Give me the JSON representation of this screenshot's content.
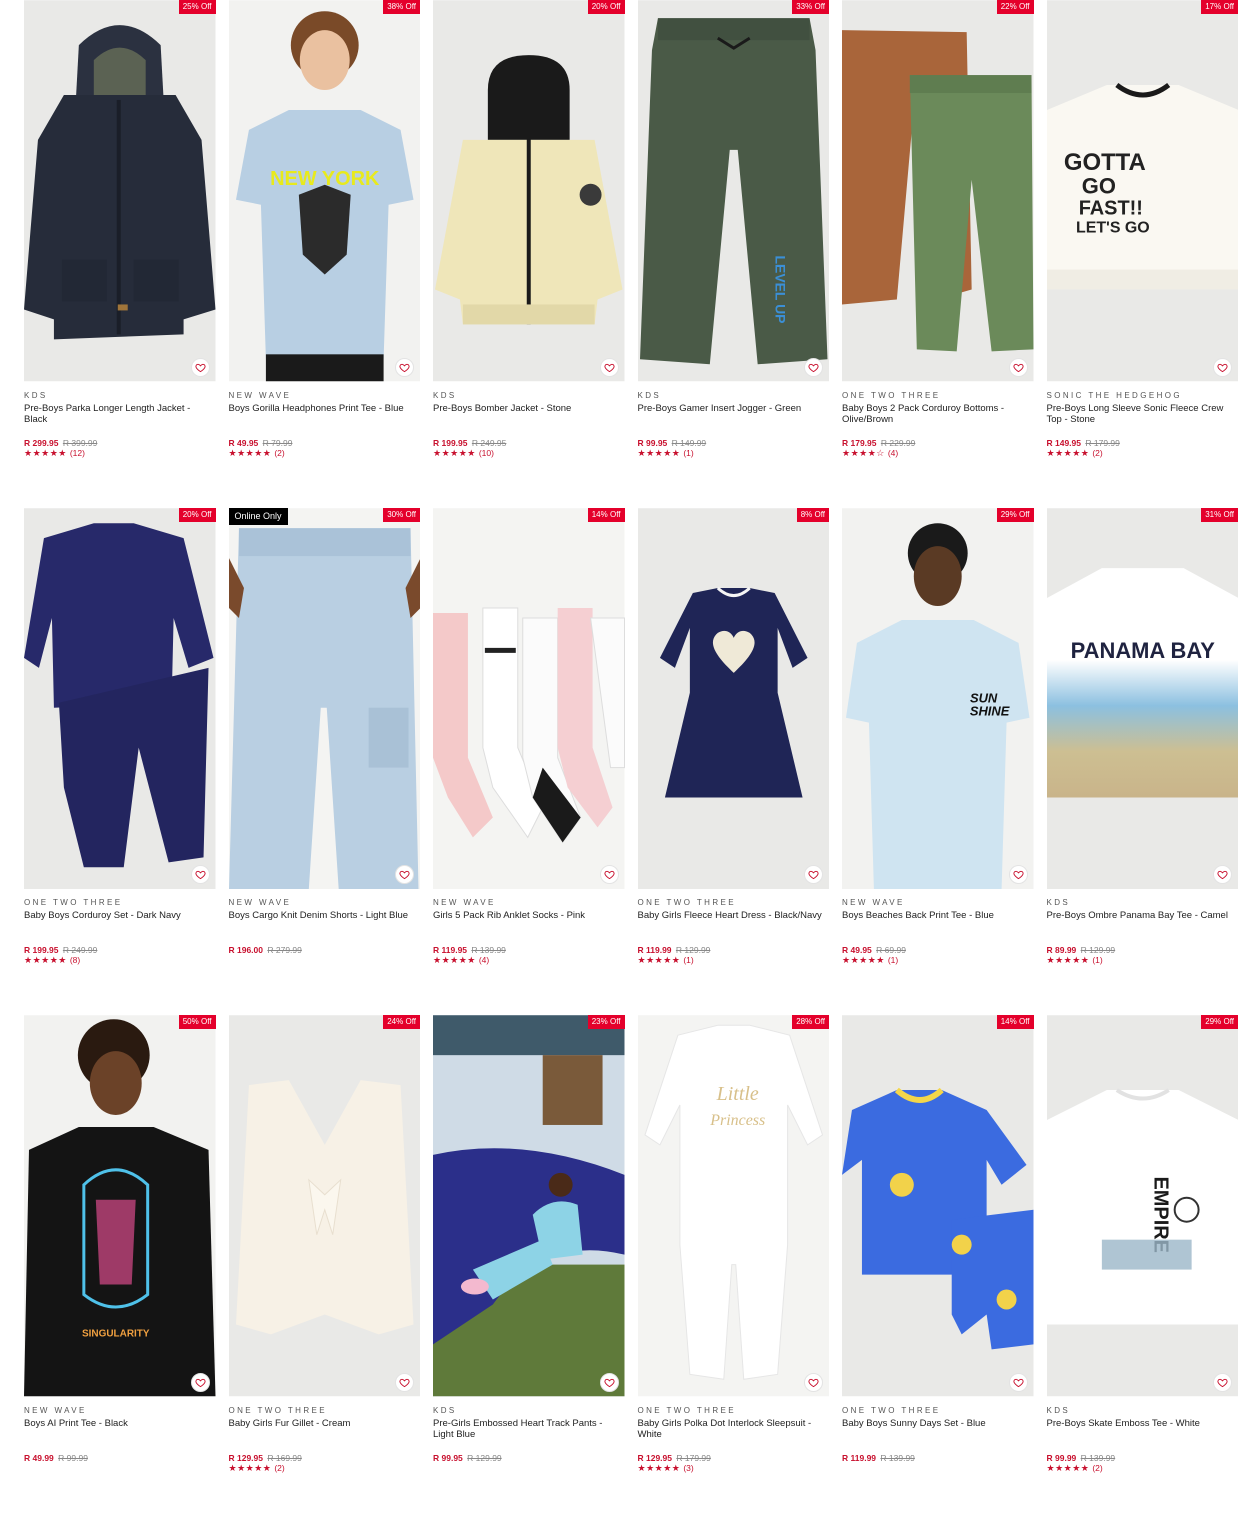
{
  "colors": {
    "accent": "#e4002b",
    "price": "#c8102e",
    "image_bg": "#e9e9e7",
    "online_badge": "#000000"
  },
  "icons": {
    "wishlist": "heart-outline-icon",
    "star": "star-icon"
  },
  "products": [
    {
      "badge": "25% Off",
      "brand": "KDS",
      "name": "Pre-Boys Parka Longer Length Jacket - Black",
      "price": "R 299.95",
      "was": "R 399.99",
      "stars": "★★★★★",
      "reviews": "(12)"
    },
    {
      "badge": "38% Off",
      "brand": "NEW WAVE",
      "name": "Boys Gorilla Headphones Print Tee - Blue",
      "price": "R 49.95",
      "was": "R 79.99",
      "stars": "★★★★★",
      "reviews": "(2)",
      "print": "NEW YORK"
    },
    {
      "badge": "20% Off",
      "brand": "KDS",
      "name": "Pre-Boys Bomber Jacket - Stone",
      "price": "R 199.95",
      "was": "R 249.95",
      "stars": "★★★★★",
      "reviews": "(10)"
    },
    {
      "badge": "33% Off",
      "brand": "KDS",
      "name": "Pre-Boys Gamer Insert Jogger - Green",
      "price": "R 99.95",
      "was": "R 149.99",
      "stars": "★★★★★",
      "reviews": "(1)",
      "print": "LEVEL UP"
    },
    {
      "badge": "22% Off",
      "brand": "ONE TWO THREE",
      "name": "Baby Boys 2 Pack Corduroy Bottoms - Olive/Brown",
      "price": "R 179.95",
      "was": "R 229.99",
      "stars": "★★★★☆",
      "reviews": "(4)"
    },
    {
      "badge": "17% Off",
      "brand": "SONIC THE HEDGEHOG",
      "name": "Pre-Boys Long Sleeve Sonic Fleece Crew Top - Stone",
      "price": "R 149.95",
      "was": "R 179.99",
      "stars": "★★★★★",
      "reviews": "(2)",
      "print": [
        "GOTTA",
        "GO",
        "FAST!!",
        "LET'S GO"
      ]
    },
    {
      "badge": "20% Off",
      "brand": "ONE TWO THREE",
      "name": "Baby Boys Corduroy Set - Dark Navy",
      "price": "R 199.95",
      "was": "R 249.99",
      "stars": "★★★★★",
      "reviews": "(8)"
    },
    {
      "badge": "30% Off",
      "online": "Online Only",
      "brand": "NEW WAVE",
      "name": "Boys Cargo Knit Denim Shorts - Light Blue",
      "price": "R 196.00",
      "was": "R 279.99",
      "stars": "",
      "reviews": ""
    },
    {
      "badge": "14% Off",
      "brand": "NEW WAVE",
      "name": "Girls 5 Pack Rib Anklet Socks - Pink",
      "price": "R 119.95",
      "was": "R 139.99",
      "stars": "★★★★★",
      "reviews": "(4)"
    },
    {
      "badge": "8% Off",
      "brand": "ONE TWO THREE",
      "name": "Baby Girls Fleece Heart Dress - Black/Navy",
      "price": "R 119.99",
      "was": "R 129.99",
      "stars": "★★★★★",
      "reviews": "(1)"
    },
    {
      "badge": "29% Off",
      "brand": "NEW WAVE",
      "name": "Boys Beaches Back Print Tee - Blue",
      "price": "R 49.95",
      "was": "R 69.99",
      "stars": "★★★★★",
      "reviews": "(1)",
      "print": [
        "SUN",
        "SHINE"
      ]
    },
    {
      "badge": "31% Off",
      "brand": "KDS",
      "name": "Pre-Boys Ombre Panama Bay Tee - Camel",
      "price": "R 89.99",
      "was": "R 129.99",
      "stars": "★★★★★",
      "reviews": "(1)",
      "print": "PANAMA BAY"
    },
    {
      "badge": "50% Off",
      "brand": "NEW WAVE",
      "name": "Boys AI Print Tee - Black",
      "price": "R 49.99",
      "was": "R 99.99",
      "stars": "",
      "reviews": "",
      "print": "SINGULARITY"
    },
    {
      "badge": "24% Off",
      "brand": "ONE TWO THREE",
      "name": "Baby Girls Fur Gillet - Cream",
      "price": "R 129.95",
      "was": "R 169.99",
      "stars": "★★★★★",
      "reviews": "(2)"
    },
    {
      "badge": "23% Off",
      "brand": "KDS",
      "name": "Pre-Girls Embossed Heart Track Pants - Light Blue",
      "price": "R 99.95",
      "was": "R 129.99",
      "stars": "",
      "reviews": ""
    },
    {
      "badge": "28% Off",
      "brand": "ONE TWO THREE",
      "name": "Baby Girls Polka Dot Interlock Sleepsuit - White",
      "price": "R 129.95",
      "was": "R 179.99",
      "stars": "★★★★★",
      "reviews": "(3)",
      "print": [
        "Little",
        "Princess"
      ]
    },
    {
      "badge": "14% Off",
      "brand": "ONE TWO THREE",
      "name": "Baby Boys Sunny Days Set - Blue",
      "price": "R 119.99",
      "was": "R 139.99",
      "stars": "",
      "reviews": ""
    },
    {
      "badge": "29% Off",
      "brand": "KDS",
      "name": "Pre-Boys Skate Emboss Tee - White",
      "price": "R 99.99",
      "was": "R 139.99",
      "stars": "★★★★★",
      "reviews": "(2)",
      "print": "EMPIRE"
    }
  ]
}
